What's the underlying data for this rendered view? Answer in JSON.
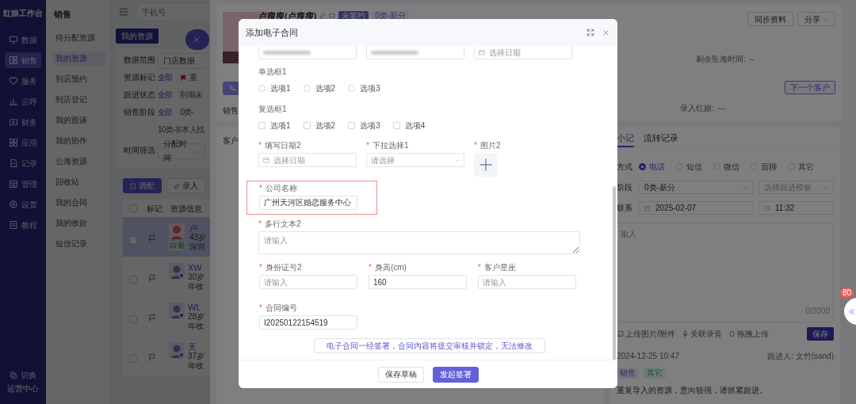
{
  "sidebar": {
    "title": "红娘工作台",
    "items": [
      {
        "label": "数据",
        "selected": false
      },
      {
        "label": "销售",
        "selected": true
      },
      {
        "label": "服务",
        "selected": false
      },
      {
        "label": "云呼",
        "selected": false
      },
      {
        "label": "财务",
        "selected": false
      },
      {
        "label": "应用",
        "selected": false
      },
      {
        "label": "记录",
        "selected": false
      },
      {
        "label": "管理",
        "selected": false
      },
      {
        "label": "设置",
        "selected": false
      },
      {
        "label": "教程",
        "selected": false
      }
    ],
    "switch": {
      "label": "切换",
      "caption": "运营中心"
    }
  },
  "submenu": {
    "title": "销售",
    "items": [
      {
        "label": "待分配资源",
        "selected": false
      },
      {
        "label": "我的资源",
        "selected": true
      },
      {
        "label": "到店预约",
        "selected": false
      },
      {
        "label": "到店登记",
        "selected": false
      },
      {
        "label": "我的面谈",
        "selected": false
      },
      {
        "label": "我的协作",
        "selected": false
      },
      {
        "label": "公海资源",
        "selected": false
      },
      {
        "label": "回收站",
        "selected": false
      },
      {
        "label": "我的合同",
        "selected": false
      },
      {
        "label": "我的收款",
        "selected": false
      },
      {
        "label": "短信记录",
        "selected": false
      }
    ]
  },
  "resources": {
    "search": {
      "placeholder": "手机号"
    },
    "tab": "我的资源",
    "filters": [
      {
        "label": "数据范围",
        "kind": "select",
        "value": "门店数据"
      },
      {
        "label": "资源标记",
        "kind": "options",
        "options": [
          {
            "label": "全部",
            "selected": true,
            "flagged": false
          },
          {
            "label": "重",
            "selected": false,
            "flagged": true
          }
        ]
      },
      {
        "label": "跟进状态",
        "kind": "options",
        "options": [
          {
            "label": "全部",
            "selected": true,
            "flagged": false
          },
          {
            "label": "到期未",
            "selected": false,
            "flagged": false
          }
        ]
      },
      {
        "label": "销售阶段",
        "kind": "options",
        "options": [
          {
            "label": "全部",
            "selected": true,
            "flagged": false
          },
          {
            "label": "0类-",
            "selected": false,
            "flagged": false
          },
          {
            "label": "10类-非本人找",
            "selected": false,
            "flagged": false
          }
        ]
      },
      {
        "label": "时间筛选",
        "kind": "select",
        "value": "分配时间"
      }
    ],
    "buttons": [
      {
        "label": "调配",
        "primary": true
      },
      {
        "label": "录入",
        "primary": false
      }
    ],
    "select_all": {
      "checked": false
    },
    "columns": [
      "标记",
      "资源信息"
    ],
    "rows": [
      {
        "name": "卢",
        "details": [
          "43岁",
          "深圳"
        ],
        "tag": "白银",
        "selected": true,
        "checked": false
      },
      {
        "name": "XW",
        "details": [
          "30岁",
          "年收"
        ],
        "kind": "default",
        "selected": false,
        "checked": false
      },
      {
        "name": "WL",
        "details": [
          "28岁",
          "年收"
        ],
        "kind": "default",
        "selected": false,
        "checked": false
      },
      {
        "name": "天",
        "details": [
          "37岁",
          "年收"
        ],
        "kind": "default",
        "selected": false,
        "checked": false
      }
    ]
  },
  "drawer": {
    "name": "卢瘦瘦(卢瘦瘦)",
    "tags": [
      {
        "label": "未签约",
        "primary": true
      },
      {
        "label": "0类-新分",
        "primary": false
      }
    ],
    "actions": [
      {
        "label": "同步资料",
        "dropdown": false
      },
      {
        "label": "分享",
        "dropdown": true
      }
    ],
    "countdown": {
      "label": "剩余坠海时间:",
      "value": "--"
    },
    "next_button": "下一个客户",
    "recorder": {
      "label": "录入红娘:",
      "value": "---"
    },
    "sales_label": "销售",
    "customer_card_title": "客户",
    "follow": {
      "tabs": [
        {
          "label": "小记",
          "selected": true
        },
        {
          "label": "流转记录",
          "selected": false
        }
      ],
      "method": {
        "label": "方式",
        "options": [
          {
            "label": "电话",
            "selected": true
          },
          {
            "label": "短信",
            "selected": false
          },
          {
            "label": "微信",
            "selected": false
          },
          {
            "label": "面聊",
            "selected": false
          },
          {
            "label": "其它",
            "selected": false
          }
        ]
      },
      "stage": {
        "label": "阶段",
        "value": "0类-新分",
        "template_placeholder": "选择跟进模板"
      },
      "contact": {
        "label": "联系",
        "date": "2025-02-07",
        "time": "11:32"
      },
      "note": {
        "placeholder": "输入",
        "counter": "0/2000"
      },
      "tools": [
        "上传图片/附件",
        "关联录音",
        "拖拽上传"
      ],
      "save": "保存",
      "record": {
        "time": "2024-12-25 10:47",
        "owner_label": "跟进人:",
        "owner": "文竹(sand)",
        "tags": [
          "销售",
          "其它"
        ],
        "text": "重复导入的资源，意向较强，请抓紧跟进。"
      }
    }
  },
  "modal": {
    "title": "添加电子合同",
    "required_mark": "*",
    "rows": [
      [
        {
          "kind": "redacted"
        },
        {
          "kind": "redacted"
        },
        {
          "kind": "date",
          "placeholder": "选择日期"
        }
      ],
      [
        {
          "kind": "radio",
          "label": "单选框1",
          "required": false,
          "options": [
            {
              "label": "选项1",
              "checked": false
            },
            {
              "label": "选项2",
              "checked": false
            },
            {
              "label": "选项3",
              "checked": false
            }
          ]
        }
      ],
      [
        {
          "kind": "checkbox",
          "label": "复选框1",
          "required": false,
          "options": [
            {
              "label": "选项1",
              "checked": false
            },
            {
              "label": "选项2",
              "checked": false
            },
            {
              "label": "选项3",
              "checked": false
            },
            {
              "label": "选项4",
              "checked": false
            }
          ]
        }
      ],
      [
        {
          "kind": "date",
          "label": "填写日期2",
          "required": true,
          "placeholder": "选择日期"
        },
        {
          "kind": "select",
          "label": "下拉选择1",
          "required": true,
          "placeholder": "请选择"
        },
        {
          "kind": "upload",
          "label": "图片2",
          "required": true
        }
      ],
      [
        {
          "kind": "text",
          "label": "公司名称",
          "required": true,
          "value": "广州天河区婚恋服务中心",
          "highlighted": true
        }
      ],
      [
        {
          "kind": "textarea",
          "label": "多行文本2",
          "required": true,
          "placeholder": "请输入"
        }
      ],
      [
        {
          "kind": "text",
          "label": "身份证号2",
          "required": true,
          "placeholder": "请输入",
          "highlighted": false
        },
        {
          "kind": "text",
          "label": "身高(cm)",
          "required": true,
          "value": "160",
          "highlighted": false
        },
        {
          "kind": "text",
          "label": "客户星座",
          "required": true,
          "placeholder": "请输入",
          "highlighted": false
        }
      ],
      [
        {
          "kind": "text",
          "label": "合同编号",
          "required": true,
          "value": "I20250122154519",
          "highlighted": false
        }
      ]
    ],
    "notice": "电子合同一经签署，合同内容将提交审核并锁定，无法修改",
    "buttons": [
      {
        "label": "保存草稿",
        "primary": false
      },
      {
        "label": "发起签署",
        "primary": true
      }
    ]
  },
  "float": {
    "badge": "80"
  }
}
